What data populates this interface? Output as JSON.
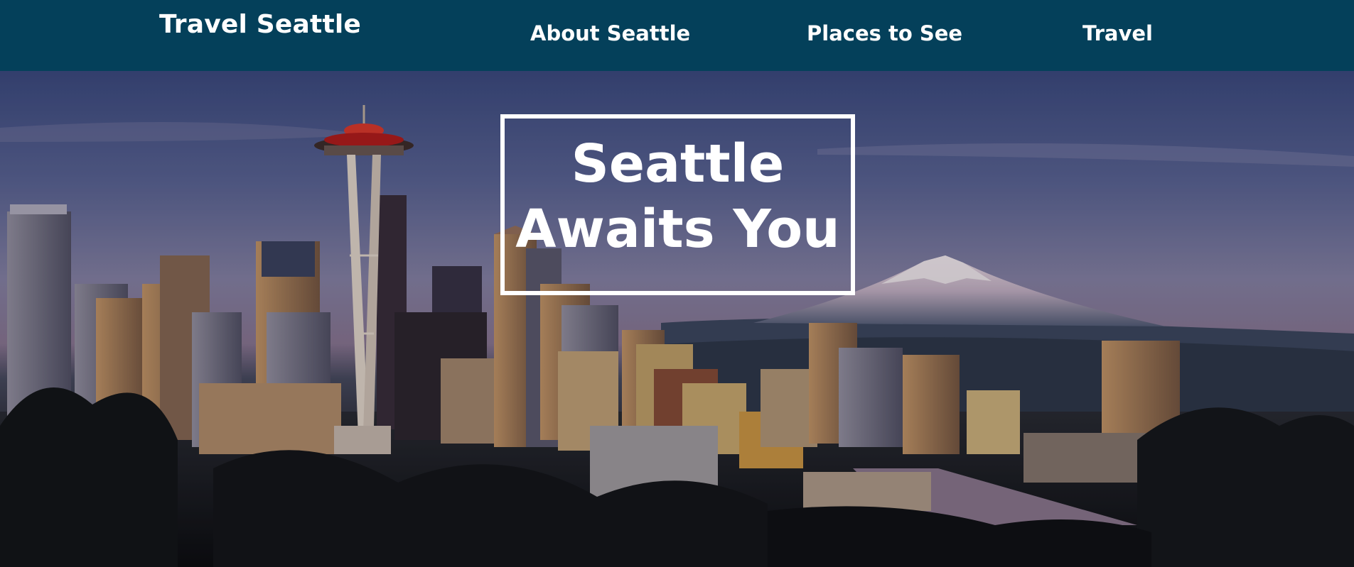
{
  "navbar": {
    "brand": "Travel Seattle",
    "links": [
      {
        "label": "About Seattle"
      },
      {
        "label": "Places to See"
      },
      {
        "label": "Travel"
      }
    ],
    "background": "#04405a"
  },
  "hero": {
    "headline_line1": "Seattle",
    "headline_line2": "Awaits You",
    "image_subject": "Seattle skyline with Space Needle and Mount Rainier at dusk",
    "headline_color": "#ffffff"
  }
}
